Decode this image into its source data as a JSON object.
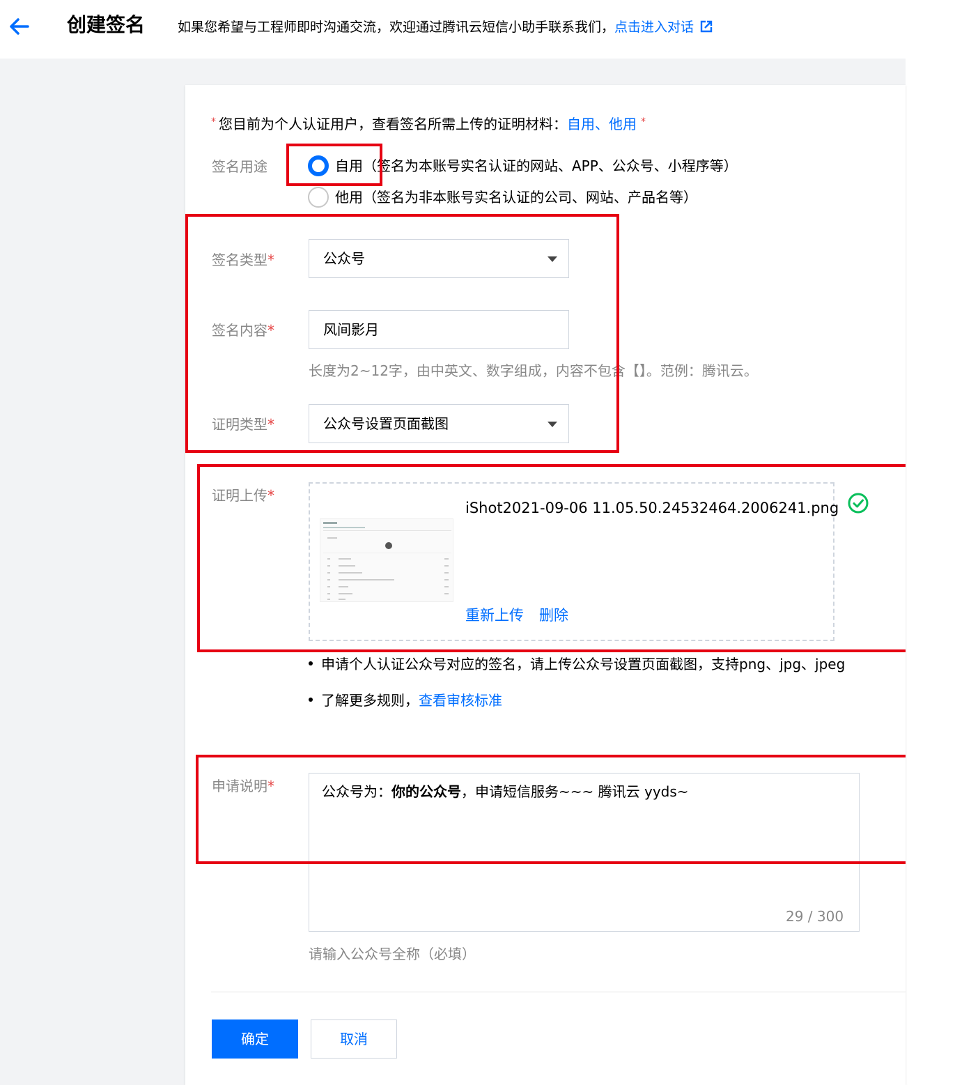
{
  "header": {
    "title": "创建签名",
    "note": "如果您希望与工程师即时沟通交流，欢迎通过腾讯云短信小助手联系我们，",
    "link_label": "点击进入对话"
  },
  "notice": {
    "text": "您目前为个人认证用户，查看签名所需上传的证明材料：",
    "link_self": "自用",
    "sep": "、",
    "link_other": "他用"
  },
  "usage": {
    "label": "签名用途",
    "options": [
      {
        "label": "自用（签名为本账号实名认证的网站、APP、公众号、小程序等）",
        "selected": true
      },
      {
        "label": "他用（签名为非本账号实名认证的公司、网站、产品名等）",
        "selected": false
      }
    ]
  },
  "sign_type": {
    "label": "签名类型",
    "value": "公众号"
  },
  "sign_content": {
    "label": "签名内容",
    "value": "风间影月",
    "hint": "长度为2~12字，由中英文、数字组成，内容不包含【】。范例：腾讯云。"
  },
  "proof_type": {
    "label": "证明类型",
    "value": "公众号设置页面截图"
  },
  "proof_upload": {
    "label": "证明上传",
    "filename": "iShot2021-09-06 11.05.50.24532464.2006241.png",
    "reupload_label": "重新上传",
    "delete_label": "删除"
  },
  "bullets": {
    "b1": "申请个人认证公众号对应的签名，请上传公众号设置页面截图，支持png、jpg、jpeg",
    "b2_text": "了解更多规则，",
    "b2_link": "查看审核标准"
  },
  "application": {
    "label": "申请说明",
    "prefix": "公众号为：",
    "bold": "你的公众号",
    "suffix": "，申请短信服务~~~ 腾讯云 yyds~",
    "counter": "29 / 300",
    "hint": "请输入公众号全称（必填）"
  },
  "buttons": {
    "confirm": "确定",
    "cancel": "取消"
  },
  "required_mark": "*",
  "colors": {
    "primary": "#006eff",
    "highlight": "#e60012",
    "success": "#0abf5b"
  }
}
